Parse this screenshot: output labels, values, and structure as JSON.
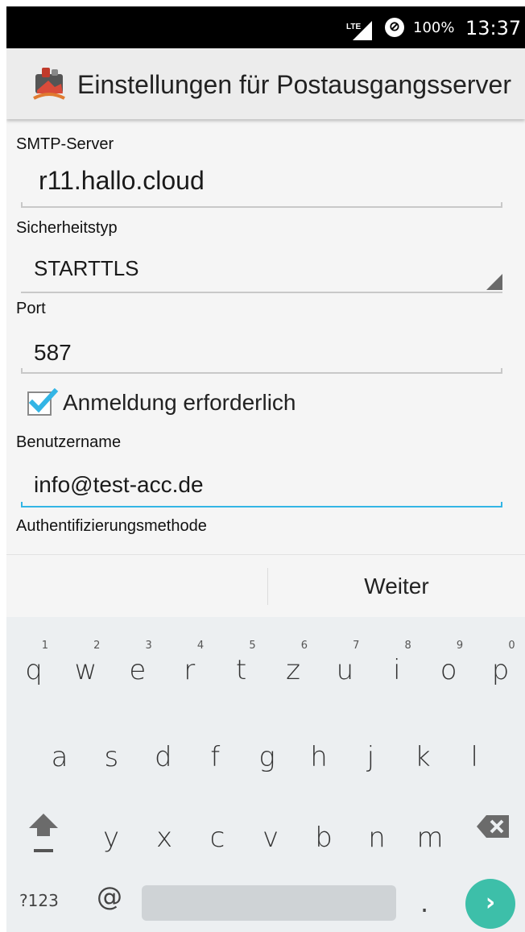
{
  "status_bar": {
    "network": "LTE",
    "data_saver_symbol": "⊘",
    "battery": "100%",
    "time": "13:37"
  },
  "app_bar": {
    "icon": "mail-app-icon",
    "title": "Einstellungen für Postausgangsserver"
  },
  "form": {
    "smtp_label": "SMTP-Server",
    "smtp_value": "r11.hallo.cloud",
    "security_label": "Sicherheitstyp",
    "security_value": "STARTTLS",
    "port_label": "Port",
    "port_value": "587",
    "auth_required_label": "Anmeldung erforderlich",
    "auth_required_checked": true,
    "username_label": "Benutzername",
    "username_value": "info@test-acc.de",
    "auth_method_label": "Authentifizierungsmethode"
  },
  "button_bar": {
    "next_label": "Weiter"
  },
  "keyboard": {
    "row1": [
      {
        "k": "q",
        "h": "1"
      },
      {
        "k": "w",
        "h": "2"
      },
      {
        "k": "e",
        "h": "3"
      },
      {
        "k": "r",
        "h": "4"
      },
      {
        "k": "t",
        "h": "5"
      },
      {
        "k": "z",
        "h": "6"
      },
      {
        "k": "u",
        "h": "7"
      },
      {
        "k": "i",
        "h": "8"
      },
      {
        "k": "o",
        "h": "9"
      },
      {
        "k": "p",
        "h": "0"
      }
    ],
    "row2": [
      "a",
      "s",
      "d",
      "f",
      "g",
      "h",
      "j",
      "k",
      "l"
    ],
    "row3": [
      "y",
      "x",
      "c",
      "v",
      "b",
      "n",
      "m"
    ],
    "symbols_label": "?123",
    "at_label": "@",
    "period_label": ".",
    "go_symbol": "›",
    "accent_color": "#3dbfa9"
  },
  "colors": {
    "input_active": "#33b5e5",
    "checkbox": "#33b5e5"
  }
}
